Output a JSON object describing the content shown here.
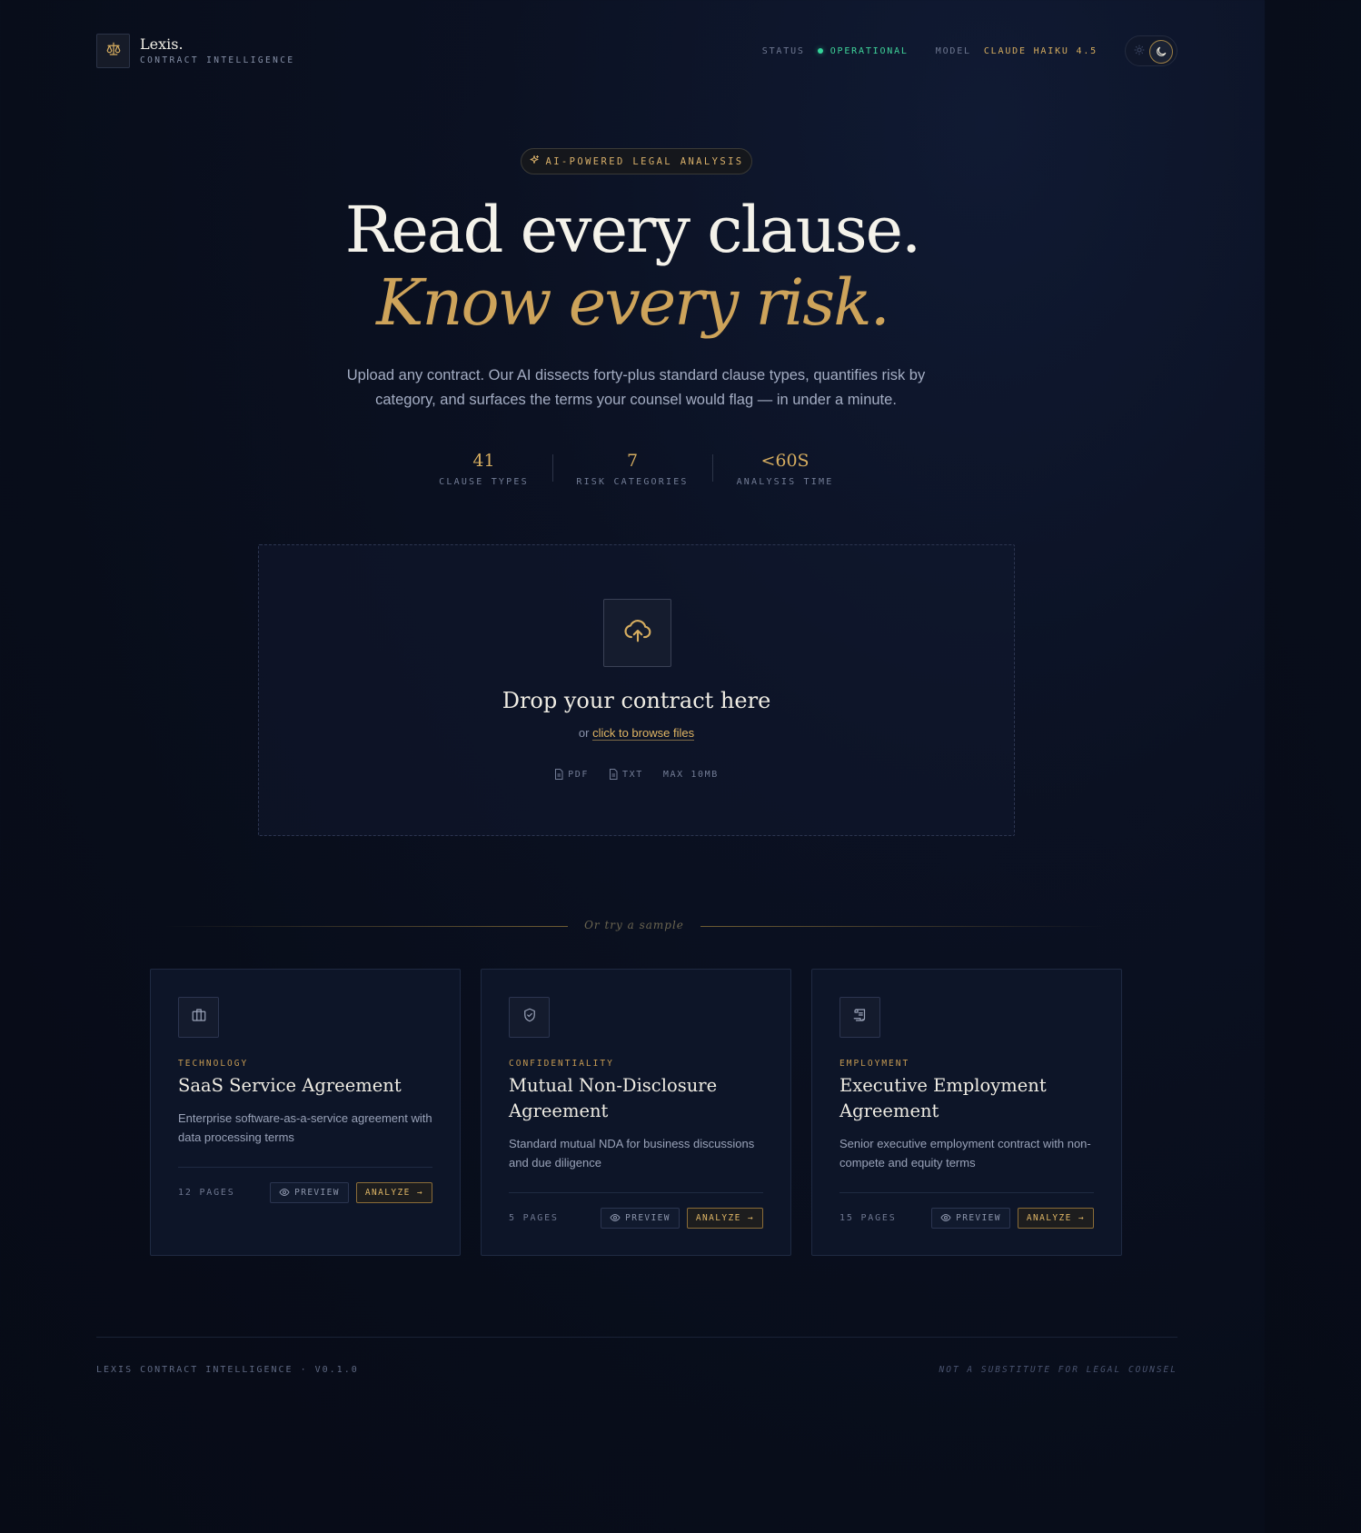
{
  "brand": {
    "name": "Lexis.",
    "subtitle": "CONTRACT INTELLIGENCE",
    "logo_icon": "scales-icon"
  },
  "status": {
    "label": "STATUS",
    "value": "OPERATIONAL",
    "model_label": "MODEL",
    "model_value": "CLAUDE HAIKU 4.5",
    "status_color": "#34d399"
  },
  "theme_toggle": {
    "light_icon": "sun-icon",
    "dark_icon": "moon-icon",
    "active": "dark"
  },
  "hero": {
    "badge": "AI-POWERED LEGAL ANALYSIS",
    "headline_1": "Read every clause.",
    "headline_2": "Know every risk.",
    "lead": "Upload any contract. Our AI dissects forty-plus standard clause types, quantifies risk by category, and surfaces the terms your counsel would flag — in under a minute."
  },
  "stats": [
    {
      "value": "41",
      "label": "CLAUSE TYPES"
    },
    {
      "value": "7",
      "label": "RISK CATEGORIES"
    },
    {
      "value": "<60S",
      "label": "ANALYSIS TIME"
    }
  ],
  "dropzone": {
    "title": "Drop your contract here",
    "or": "or",
    "browse": "click to browse files",
    "formats": [
      "PDF",
      "TXT"
    ],
    "max": "MAX 10MB"
  },
  "samples_divider": "Or try a sample",
  "samples": [
    {
      "icon": "briefcase-icon",
      "category": "TECHNOLOGY",
      "title": "SaaS Service Agreement",
      "description": "Enterprise software-as-a-service agreement with data processing terms",
      "pages": "12 PAGES",
      "preview": "PREVIEW",
      "analyze": "ANALYZE →"
    },
    {
      "icon": "shield-icon",
      "category": "CONFIDENTIALITY",
      "title": "Mutual Non-Disclosure Agreement",
      "description": "Standard mutual NDA for business discussions and due diligence",
      "pages": "5 PAGES",
      "preview": "PREVIEW",
      "analyze": "ANALYZE →"
    },
    {
      "icon": "scroll-icon",
      "category": "EMPLOYMENT",
      "title": "Executive Employment Agreement",
      "description": "Senior executive employment contract with non-compete and equity terms",
      "pages": "15 PAGES",
      "preview": "PREVIEW",
      "analyze": "ANALYZE →"
    }
  ],
  "footer": {
    "left": "LEXIS CONTRACT INTELLIGENCE · V0.1.0",
    "right": "NOT A SUBSTITUTE FOR LEGAL COUNSEL"
  },
  "colors": {
    "accent_gold": "#d6ad60",
    "background": "#0a1020",
    "status_green": "#34d399"
  }
}
